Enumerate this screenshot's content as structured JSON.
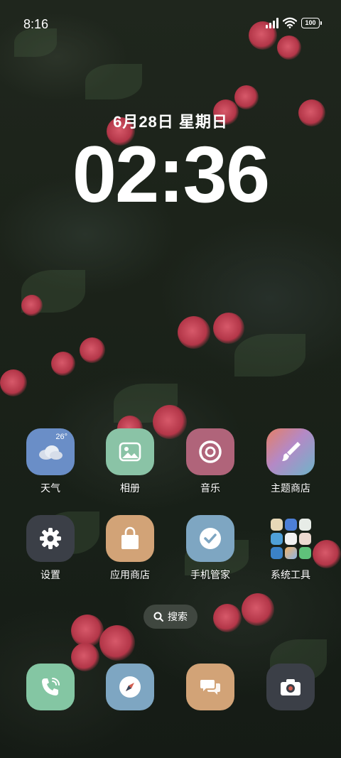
{
  "status_bar": {
    "time": "8:16",
    "battery": "100"
  },
  "lockscreen": {
    "date": "6月28日 星期日",
    "clock": "02:36"
  },
  "weather": {
    "temp": "26°"
  },
  "apps_row1": [
    {
      "label": "天气",
      "icon": "weather-icon",
      "color": "#6a8ec7"
    },
    {
      "label": "相册",
      "icon": "gallery-icon",
      "color": "#8ac3a6"
    },
    {
      "label": "音乐",
      "icon": "music-icon",
      "color": "#b0647a"
    },
    {
      "label": "主题商店",
      "icon": "brush-icon",
      "color": "#e09a6a"
    }
  ],
  "apps_row2": [
    {
      "label": "设置",
      "icon": "gear-icon",
      "color": "#3b3f47"
    },
    {
      "label": "应用商店",
      "icon": "shopping-bag-icon",
      "color": "#d2a377"
    },
    {
      "label": "手机管家",
      "icon": "check-shield-icon",
      "color": "#7ea6c2"
    },
    {
      "label": "系统工具",
      "icon": "folder-icon",
      "color": "transparent"
    }
  ],
  "search": {
    "label": "搜索"
  },
  "dock": [
    {
      "icon": "phone-icon",
      "color": "#84c6a3"
    },
    {
      "icon": "compass-icon",
      "color": "#7ea6c2"
    },
    {
      "icon": "message-icon",
      "color": "#d2a377"
    },
    {
      "icon": "camera-icon",
      "color": "#3b3f47"
    }
  ]
}
